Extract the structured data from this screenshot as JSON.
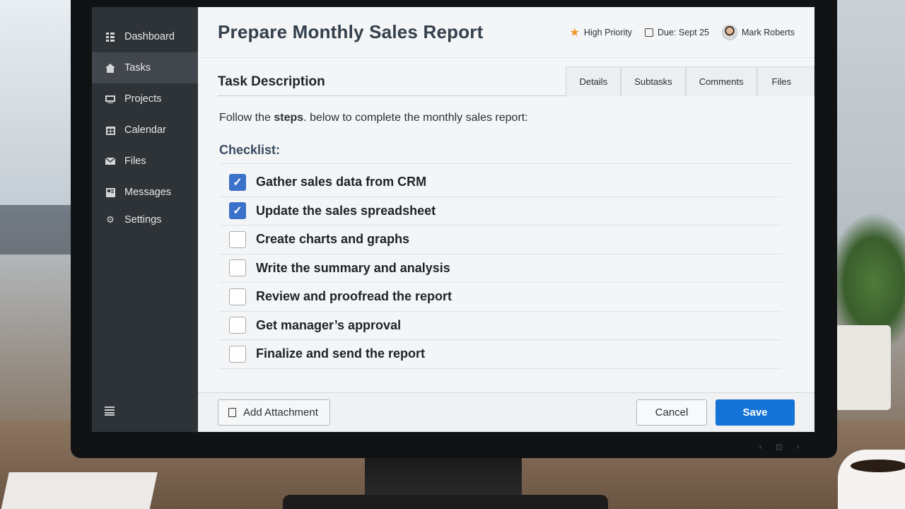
{
  "sidebar": {
    "items": [
      {
        "label": "Dashboard",
        "icon": "dashboard-icon"
      },
      {
        "label": "Tasks",
        "icon": "home-icon"
      },
      {
        "label": "Projects",
        "icon": "projects-icon"
      },
      {
        "label": "Calendar",
        "icon": "calendar-icon"
      },
      {
        "label": "Files",
        "icon": "mail-icon"
      },
      {
        "label": "Messages",
        "icon": "messages-icon"
      },
      {
        "label": "Settings",
        "icon": "gear-icon"
      }
    ],
    "active": "Tasks"
  },
  "header": {
    "title": "Prepare Monthly Sales Report",
    "priority": "High Priority",
    "due": "Due: Sept 25",
    "assignee": "Mark Roberts"
  },
  "section": {
    "title": "Task Description",
    "tabs": [
      "Details",
      "Subtasks",
      "Comments",
      "Files"
    ]
  },
  "content": {
    "intro_prefix": "Follow the",
    "intro_emphasis": "steps",
    "intro_suffix": ". below to complete the monthly sales report:",
    "checklist_title": "Checklist:",
    "checklist": [
      {
        "label": "Gather sales data from CRM",
        "checked": true
      },
      {
        "label": "Update the sales spreadsheet",
        "checked": true
      },
      {
        "label": "Create charts and graphs",
        "checked": false
      },
      {
        "label": "Write the summary and analysis",
        "checked": false
      },
      {
        "label": "Review and proofread the report",
        "checked": false
      },
      {
        "label": "Get manager’s approval",
        "checked": false
      },
      {
        "label": "Finalize and send the report",
        "checked": false
      }
    ]
  },
  "footer": {
    "attach_label": "Add Attachment",
    "cancel_label": "Cancel",
    "save_label": "Save"
  },
  "colors": {
    "sidebar_bg": "#2e3338",
    "accent": "#1572d6",
    "checkbox_checked": "#3a72c9",
    "priority_star": "#f0932b"
  }
}
